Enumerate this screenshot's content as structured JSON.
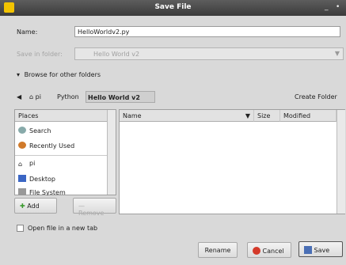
{
  "window": {
    "title": "Save File",
    "controls": [
      "_",
      "•"
    ]
  },
  "form": {
    "name_label": "Name:",
    "name_value": "HelloWorldv2.py",
    "save_in_label": "Save in folder:",
    "save_in_value": "Hello World v2"
  },
  "browse_label": "Browse for other folders",
  "pathbar": {
    "back": "◀",
    "crumbs": [
      "pi",
      "Python",
      "Hello World v2"
    ],
    "create_folder": "Create Folder"
  },
  "places": {
    "header": "Places",
    "items": [
      "Search",
      "Recently Used",
      "pi",
      "Desktop",
      "File System"
    ],
    "add_label": "Add",
    "remove_label": "Remove"
  },
  "files": {
    "columns": [
      "Name",
      "Size",
      "Modified"
    ],
    "sort_arrow": "▼"
  },
  "open_in_tab_label": "Open file in a new tab",
  "actions": {
    "rename": "Rename",
    "cancel": "Cancel",
    "save": "Save"
  }
}
